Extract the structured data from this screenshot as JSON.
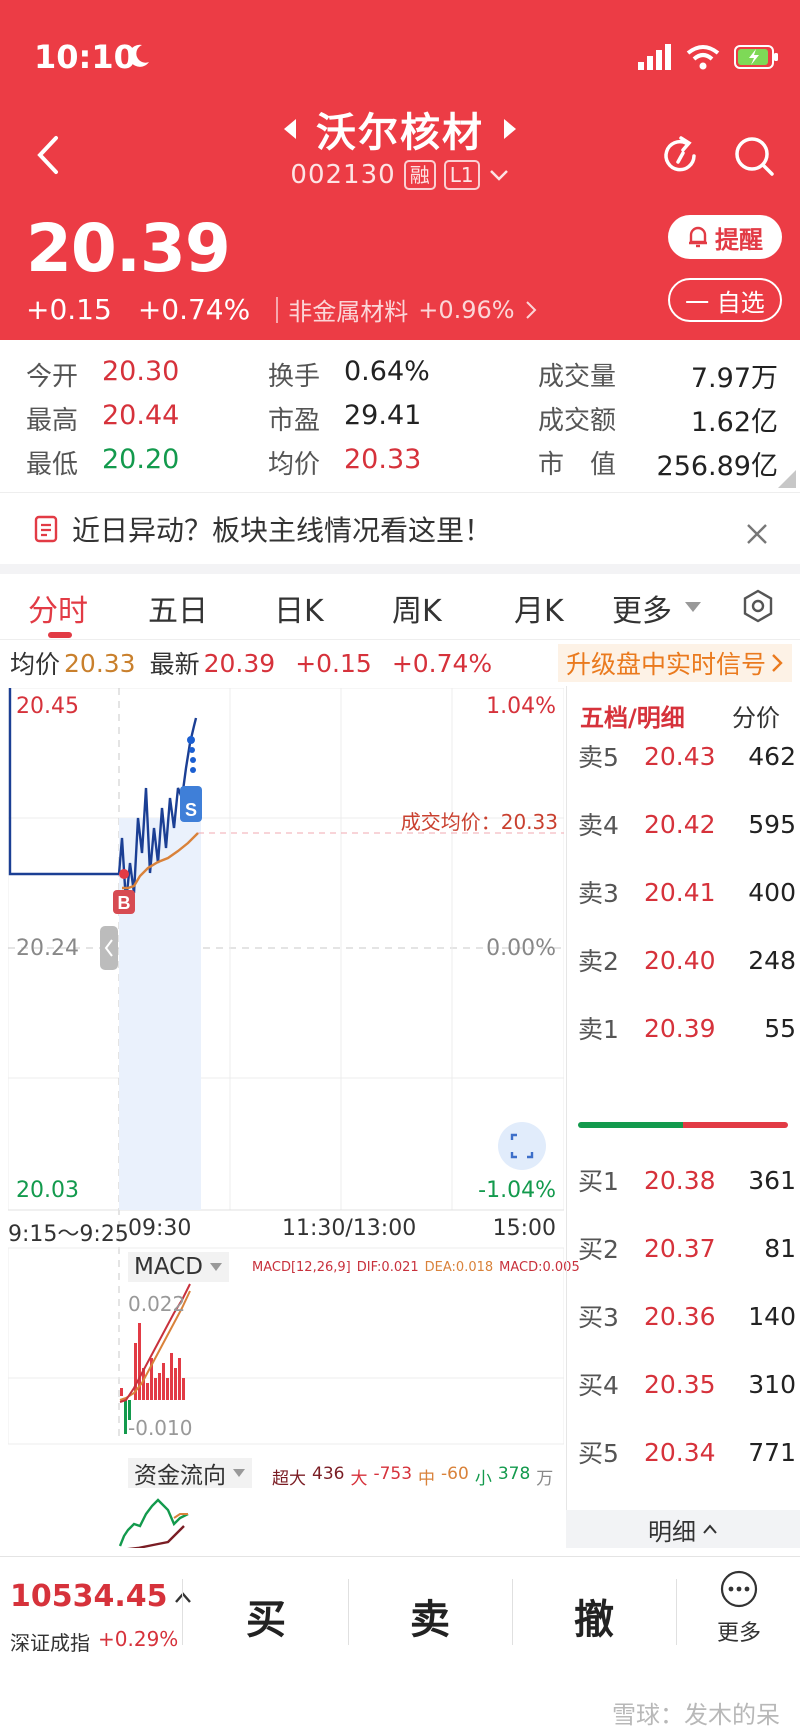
{
  "status_bar": {
    "time": "10:10"
  },
  "header": {
    "title": "沃尔核材",
    "code": "002130",
    "tag_margin": "融",
    "tag_level": "L1",
    "price": "20.39",
    "change": "+0.15",
    "change_pct": "+0.74%",
    "sector_name": "非金属材料",
    "sector_pct": "+0.96%",
    "alert_label": "提醒",
    "watch_label": "一 自选"
  },
  "stats": {
    "open_label": "今开",
    "open_value": "20.30",
    "high_label": "最高",
    "high_value": "20.44",
    "low_label": "最低",
    "low_value": "20.20",
    "turnover_label": "换手",
    "turnover_value": "0.64%",
    "pe_label": "市盈",
    "pe_value": "29.41",
    "avg_label": "均价",
    "avg_value": "20.33",
    "volume_label": "成交量",
    "volume_value": "7.97万",
    "amount_label": "成交额",
    "amount_value": "1.62亿",
    "cap_label": "市　值",
    "cap_value": "256.89亿"
  },
  "notice": {
    "text": "近日异动？板块主线情况看这里！"
  },
  "tabs": [
    "分时",
    "五日",
    "日K",
    "周K",
    "月K",
    "更多"
  ],
  "infobar": {
    "avg_label": "均价",
    "avg_value": "20.33",
    "latest_label": "最新",
    "latest_value": "20.39",
    "change": "+0.15",
    "change_pct": "+0.74%",
    "upgrade": "升级盘中实时信号"
  },
  "chart": {
    "y_top": "20.45",
    "y_mid": "20.24",
    "y_bottom": "20.03",
    "pct_top": "1.04%",
    "pct_mid": "0.00%",
    "pct_bottom": "-1.04%",
    "avg_label": "成交均价：20.33",
    "time_labels": [
      "9:15～9:25",
      "09:30",
      "11:30/13:00",
      "15:00"
    ],
    "buy_marker": "B",
    "sell_marker": "S",
    "macd_title": "MACD",
    "macd_params": "MACD[12,26,9]",
    "macd_dif": "DIF:0.021",
    "macd_dea": "DEA:0.018",
    "macd_val": "MACD:0.005",
    "macd_top": "0.022",
    "macd_bottom": "-0.010",
    "flow_title": "资金流向",
    "flow_super_label": "超大",
    "flow_super": "436",
    "flow_large_label": "大",
    "flow_large": "-753",
    "flow_mid_label": "中",
    "flow_mid": "-60",
    "flow_small_label": "小",
    "flow_small": "378",
    "flow_unit": "万"
  },
  "order_book": {
    "title": "五档/明细",
    "tab2": "分价",
    "asks": [
      {
        "label": "卖5",
        "price": "20.43",
        "vol": "462"
      },
      {
        "label": "卖4",
        "price": "20.42",
        "vol": "595"
      },
      {
        "label": "卖3",
        "price": "20.41",
        "vol": "400"
      },
      {
        "label": "卖2",
        "price": "20.40",
        "vol": "248"
      },
      {
        "label": "卖1",
        "price": "20.39",
        "vol": "55"
      }
    ],
    "bids": [
      {
        "label": "买1",
        "price": "20.38",
        "vol": "361"
      },
      {
        "label": "买2",
        "price": "20.37",
        "vol": "81"
      },
      {
        "label": "买3",
        "price": "20.36",
        "vol": "140"
      },
      {
        "label": "买4",
        "price": "20.35",
        "vol": "310"
      },
      {
        "label": "买5",
        "price": "20.34",
        "vol": "771"
      }
    ],
    "detail_label": "明细"
  },
  "bottom_bar": {
    "index_value": "10534.45",
    "index_name": "深证成指",
    "index_pct": "+0.29%",
    "buy": "买",
    "sell": "卖",
    "cancel": "撤",
    "more": "更多"
  },
  "watermark": "雪球：发木的呆",
  "colors": {
    "header_red": "#ec3c45",
    "up_red": "#d6323b",
    "down_green": "#139a4d",
    "price_line": "#1b3f94",
    "avg_line": "#d9823a"
  }
}
